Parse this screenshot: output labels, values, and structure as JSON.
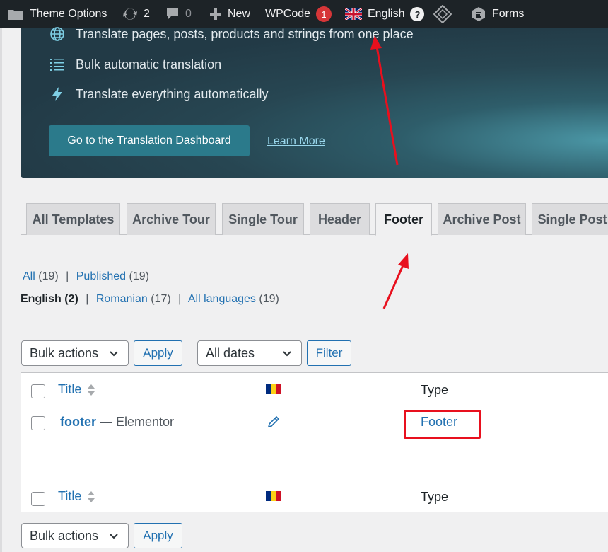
{
  "adminbar": {
    "theme_options": "Theme Options",
    "updates_count": "2",
    "comments_count": "0",
    "new_label": "New",
    "wpcode_label": "WPCode",
    "wpcode_badge": "1",
    "language_label": "English",
    "help_label": "?",
    "forms_label": "Forms"
  },
  "promo": {
    "features": [
      "Translate pages, posts, products and strings from one place",
      "Bulk automatic translation",
      "Translate everything automatically"
    ],
    "dashboard_button": "Go to the Translation Dashboard",
    "learn_more": "Learn More"
  },
  "tabs": [
    "All Templates",
    "Archive Tour",
    "Single Tour",
    "Header",
    "Footer",
    "Archive Post",
    "Single Post"
  ],
  "active_tab": "Footer",
  "filters": {
    "all_label": "All",
    "all_count": "(19)",
    "published_label": "Published",
    "published_count": "(19)"
  },
  "languages": {
    "current": "English (2)",
    "romanian_label": "Romanian",
    "romanian_count": "(17)",
    "all_label": "All languages",
    "all_count": "(19)",
    "separator": "|"
  },
  "controls": {
    "bulk_actions": "Bulk actions",
    "apply": "Apply",
    "dates": "All dates",
    "filter": "Filter"
  },
  "table": {
    "col_title": "Title",
    "col_type": "Type",
    "row": {
      "title_link": "footer",
      "title_suffix": " — Elementor",
      "type": "Footer"
    }
  },
  "colors": {
    "adminbar_bg": "#1d2327",
    "link_blue": "#2271b1",
    "highlight_red": "#e8101e",
    "badge_red": "#d63638"
  },
  "icons": [
    "folder-icon",
    "updates-icon",
    "comment-icon",
    "plus-icon",
    "uk-flag-icon",
    "wpml-diamond-icon",
    "forms-icon",
    "globe-icon",
    "list-icon",
    "bolt-icon",
    "sort-icon",
    "romanian-flag-icon",
    "pencil-icon",
    "chevron-down-icon"
  ]
}
